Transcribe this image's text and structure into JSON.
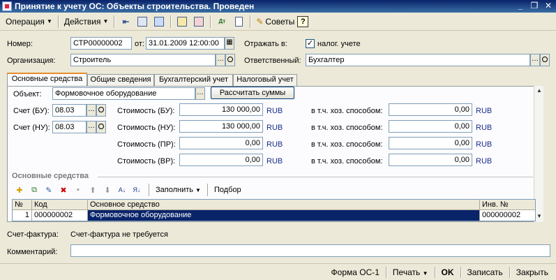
{
  "window": {
    "title": "Принятие к учету ОС: Объекты строительства. Проведен"
  },
  "toolbar": {
    "operation_label": "Операция",
    "actions_label": "Действия",
    "advice_label": "Советы",
    "help_glyph": "?"
  },
  "header": {
    "number_label": "Номер:",
    "number_value": "СТР00000002",
    "date_label": "от:",
    "date_value": "31.01.2009 12:00:00",
    "reflect_label": "Отражать в:",
    "tax_check_label": "налог. учете",
    "tax_checked": true,
    "org_label": "Организация:",
    "org_value": "Строитель",
    "responsible_label": "Ответственный:",
    "responsible_value": "Бухгалтер"
  },
  "tabs": [
    {
      "label": "Основные средства",
      "active": true
    },
    {
      "label": "Общие сведения",
      "active": false
    },
    {
      "label": "Бухгалтерский учет",
      "active": false
    },
    {
      "label": "Налоговый учет",
      "active": false
    }
  ],
  "asset_tab": {
    "object_label": "Объект:",
    "object_value": "Формовочное оборудование",
    "calc_button": "Рассчитать суммы",
    "account_bu_label": "Счет (БУ):",
    "account_bu_value": "08.03",
    "account_nu_label": "Счет (НУ):",
    "account_nu_value": "08.03",
    "costs": [
      {
        "label": "Стоимость (БУ):",
        "value": "130 000,00",
        "unit": "RUB",
        "hoz_label": "в т.ч. хоз. способом:",
        "hoz_value": "0,00",
        "hoz_unit": "RUB"
      },
      {
        "label": "Стоимость (НУ):",
        "value": "130 000,00",
        "unit": "RUB",
        "hoz_label": "в т.ч. хоз. способом:",
        "hoz_value": "0,00",
        "hoz_unit": "RUB"
      },
      {
        "label": "Стоимость (ПР):",
        "value": "0,00",
        "unit": "RUB",
        "hoz_label": "в т.ч. хоз. способом:",
        "hoz_value": "0,00",
        "hoz_unit": "RUB"
      },
      {
        "label": "Стоимость (ВР):",
        "value": "0,00",
        "unit": "RUB",
        "hoz_label": "в т.ч. хоз. способом:",
        "hoz_value": "0,00",
        "hoz_unit": "RUB"
      }
    ],
    "section_title": "Основные средства",
    "fill_label": "Заполнить",
    "select_label": "Подбор",
    "table": {
      "columns": [
        "№",
        "Код",
        "Основное средство",
        "Инв. №"
      ],
      "rows": [
        {
          "n": "1",
          "code": "000000002",
          "asset": "Формовочное оборудование",
          "inv": "000000002"
        }
      ]
    }
  },
  "footer_fields": {
    "invoice_label": "Счет-фактура:",
    "invoice_value": "Счет-фактура не требуется",
    "comment_label": "Комментарий:",
    "comment_value": ""
  },
  "statusbar": {
    "form_label": "Форма ОС-1",
    "print_label": "Печать",
    "ok_label": "OK",
    "save_label": "Записать",
    "close_label": "Закрыть"
  }
}
